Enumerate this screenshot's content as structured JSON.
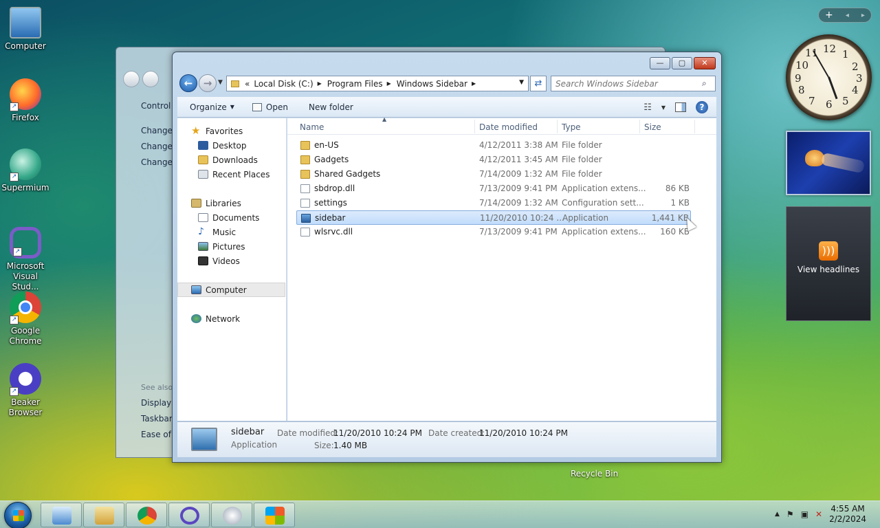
{
  "desktop": {
    "icons": [
      {
        "label": "Computer"
      },
      {
        "label": "Firefox"
      },
      {
        "label": "Supermium"
      },
      {
        "label": "Microsoft Visual Stud..."
      },
      {
        "label": "Google Chrome"
      },
      {
        "label": "Beaker Browser"
      }
    ],
    "recycle_bin_label": "Recycle Bin"
  },
  "gadgets": {
    "bar": {
      "add": "+",
      "prev": "◂",
      "next": "▸"
    },
    "clock_numbers": [
      "12",
      "1",
      "2",
      "3",
      "4",
      "5",
      "6",
      "7",
      "8",
      "9",
      "10",
      "11"
    ],
    "feed": {
      "label": "View headlines"
    }
  },
  "background_window": {
    "links": [
      "Control I",
      "Change",
      "Change",
      "Change"
    ],
    "see_also": "See also",
    "bottom_links": [
      "Display",
      "Taskbar",
      "Ease of A"
    ]
  },
  "explorer": {
    "caption": {
      "minimize": "—",
      "maximize": "▢",
      "close": "✕"
    },
    "address": {
      "overflow": "«",
      "segments": [
        "Local Disk (C:)",
        "Program Files",
        "Windows Sidebar"
      ]
    },
    "search_placeholder": "Search Windows Sidebar",
    "toolbar": {
      "organize": "Organize",
      "open": "Open",
      "new_folder": "New folder"
    },
    "nav": {
      "favorites": "Favorites",
      "desktop": "Desktop",
      "downloads": "Downloads",
      "recent": "Recent Places",
      "libraries": "Libraries",
      "documents": "Documents",
      "music": "Music",
      "pictures": "Pictures",
      "videos": "Videos",
      "computer": "Computer",
      "network": "Network"
    },
    "columns": {
      "name": "Name",
      "date": "Date modified",
      "type": "Type",
      "size": "Size"
    },
    "files": [
      {
        "name": "en-US",
        "date": "4/12/2011 3:38 AM",
        "type": "File folder",
        "size": "",
        "kind": "folder"
      },
      {
        "name": "Gadgets",
        "date": "4/12/2011 3:45 AM",
        "type": "File folder",
        "size": "",
        "kind": "folder"
      },
      {
        "name": "Shared Gadgets",
        "date": "7/14/2009 1:32 AM",
        "type": "File folder",
        "size": "",
        "kind": "folder"
      },
      {
        "name": "sbdrop.dll",
        "date": "7/13/2009 9:41 PM",
        "type": "Application extens...",
        "size": "86 KB",
        "kind": "file"
      },
      {
        "name": "settings",
        "date": "7/14/2009 1:32 AM",
        "type": "Configuration sett...",
        "size": "1 KB",
        "kind": "file"
      },
      {
        "name": "sidebar",
        "date": "11/20/2010 10:24 ...",
        "type": "Application",
        "size": "1,441 KB",
        "kind": "app"
      },
      {
        "name": "wlsrvc.dll",
        "date": "7/13/2009 9:41 PM",
        "type": "Application extens...",
        "size": "160 KB",
        "kind": "file"
      }
    ],
    "selected_index": 5,
    "details": {
      "name": "sidebar",
      "type": "Application",
      "date_modified_label": "Date modified:",
      "date_modified": "11/20/2010 10:24 PM",
      "date_created_label": "Date created:",
      "date_created": "11/20/2010 10:24 PM",
      "size_label": "Size:",
      "size": "1.40 MB"
    }
  },
  "taskbar": {
    "time": "4:55 AM",
    "date": "2/2/2024"
  },
  "colors": {
    "selection": "#c1dcfb",
    "accent": "#1d5ba8",
    "folder": "#e8c35a"
  }
}
